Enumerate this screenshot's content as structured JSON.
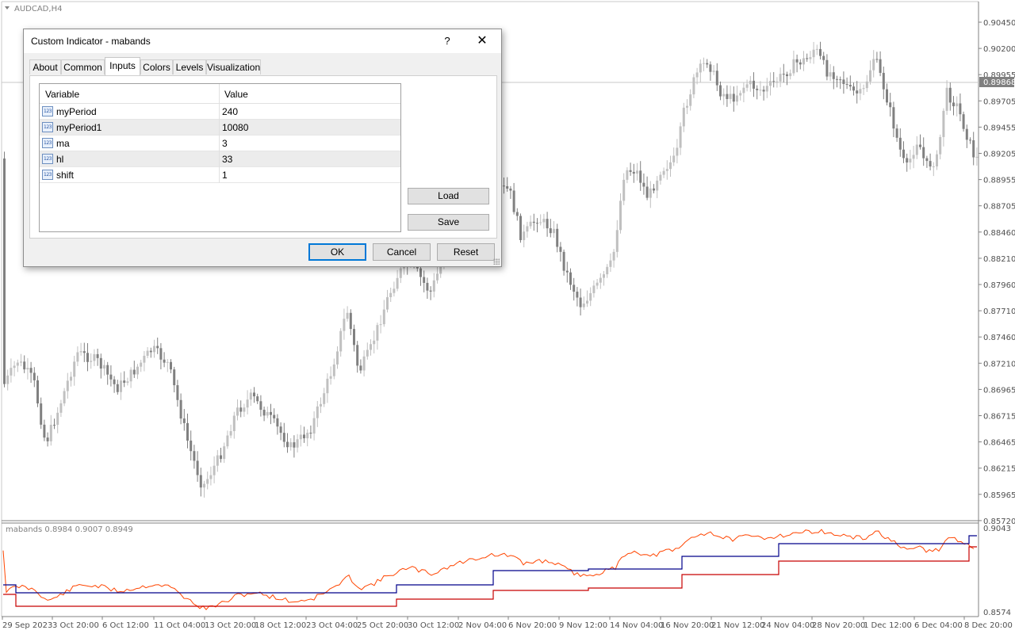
{
  "chart": {
    "symbol_label": "AUDCAD,H4",
    "current_price": "0.89868",
    "price_ticks": [
      "0.90450",
      "0.90200",
      "0.89955",
      "0.89705",
      "0.89455",
      "0.89205",
      "0.88955",
      "0.88705",
      "0.88460",
      "0.88210",
      "0.87960",
      "0.87710",
      "0.87460",
      "0.87210",
      "0.86965",
      "0.86715",
      "0.86465",
      "0.86215",
      "0.85965",
      "0.85720"
    ],
    "time_ticks": [
      "29 Sep 2023",
      "3 Oct 20:00",
      "6 Oct 12:00",
      "11 Oct 04:00",
      "13 Oct 20:00",
      "18 Oct 12:00",
      "23 Oct 04:00",
      "25 Oct 20:00",
      "30 Oct 12:00",
      "2 Nov 04:00",
      "6 Nov 20:00",
      "9 Nov 12:00",
      "14 Nov 04:00",
      "16 Nov 20:00",
      "21 Nov 12:00",
      "24 Nov 04:00",
      "28 Nov 20:00",
      "1 Dec 12:00",
      "6 Dec 04:00",
      "8 Dec 20:00"
    ],
    "indicator_label": "mabands 0.8984 0.9007 0.8949",
    "indicator_top_tick": "0.9043",
    "indicator_bottom_tick": "0.8574",
    "colors": {
      "up_candle": "#c0c0c0",
      "down_candle": "#808080",
      "upper_band": "#00008b",
      "lower_band": "#c80000",
      "price_line": "#ff4500"
    }
  },
  "dialog": {
    "title": "Custom Indicator - mabands",
    "help_label": "?",
    "close_label": "✕",
    "tabs": [
      "About",
      "Common",
      "Inputs",
      "Colors",
      "Levels",
      "Visualization"
    ],
    "active_tab": "Inputs",
    "grid": {
      "col_variable": "Variable",
      "col_value": "Value",
      "row_icon_text": "123",
      "rows": [
        {
          "variable": "myPeriod",
          "value": "240"
        },
        {
          "variable": "myPeriod1",
          "value": "10080"
        },
        {
          "variable": "ma",
          "value": "3"
        },
        {
          "variable": "hl",
          "value": "33"
        },
        {
          "variable": "shift",
          "value": "1"
        }
      ]
    },
    "buttons": {
      "load": "Load",
      "save": "Save",
      "ok": "OK",
      "cancel": "Cancel",
      "reset": "Reset"
    }
  }
}
